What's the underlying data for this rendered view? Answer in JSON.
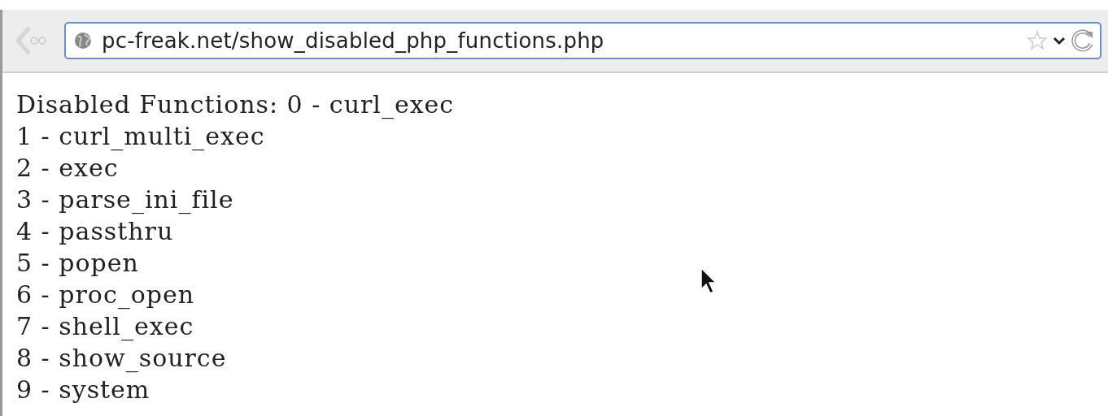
{
  "toolbar": {
    "back_button": {
      "disabled": true
    },
    "address_bar": {
      "value": "pc-freak.net/show_disabled_php_functions.php"
    }
  },
  "page": {
    "lines": [
      "Disabled Functions: 0 - curl_exec",
      "1 - curl_multi_exec",
      "2 - exec",
      "3 - parse_ini_file",
      "4 - passthru",
      "5 - popen",
      "6 - proc_open",
      "7 - shell_exec",
      "8 - show_source",
      "9 - system"
    ]
  }
}
